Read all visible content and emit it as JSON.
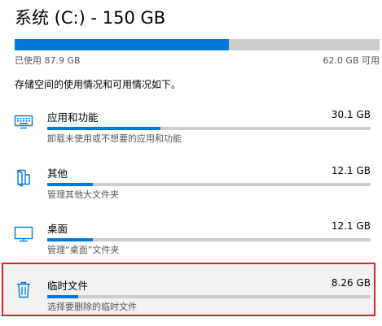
{
  "colors": {
    "accent": "#0078d7",
    "highlight_border": "#e0212d"
  },
  "drive": {
    "title": "系统 (C:) - 150 GB",
    "used_label": "已使用 87.9 GB",
    "free_label": "62.0 GB 可用",
    "used_fraction": 0.586
  },
  "intro": "存储空间的使用情况和可用情况如下。",
  "categories": [
    {
      "name": "应用和功能",
      "size": "30.1 GB",
      "description": "卸载未使用或不想要的应用和功能",
      "icon": "keyboard-icon",
      "fraction": 0.35
    },
    {
      "name": "其他",
      "size": "12.1 GB",
      "description": "管理其他大文件夹",
      "icon": "folder-icon",
      "fraction": 0.14
    },
    {
      "name": "桌面",
      "size": "12.1 GB",
      "description": "管理“桌面”文件夹",
      "icon": "monitor-icon",
      "fraction": 0.14
    },
    {
      "name": "临时文件",
      "size": "8.26 GB",
      "description": "选择要删除的临时文件",
      "icon": "trash-icon",
      "fraction": 0.095
    }
  ]
}
